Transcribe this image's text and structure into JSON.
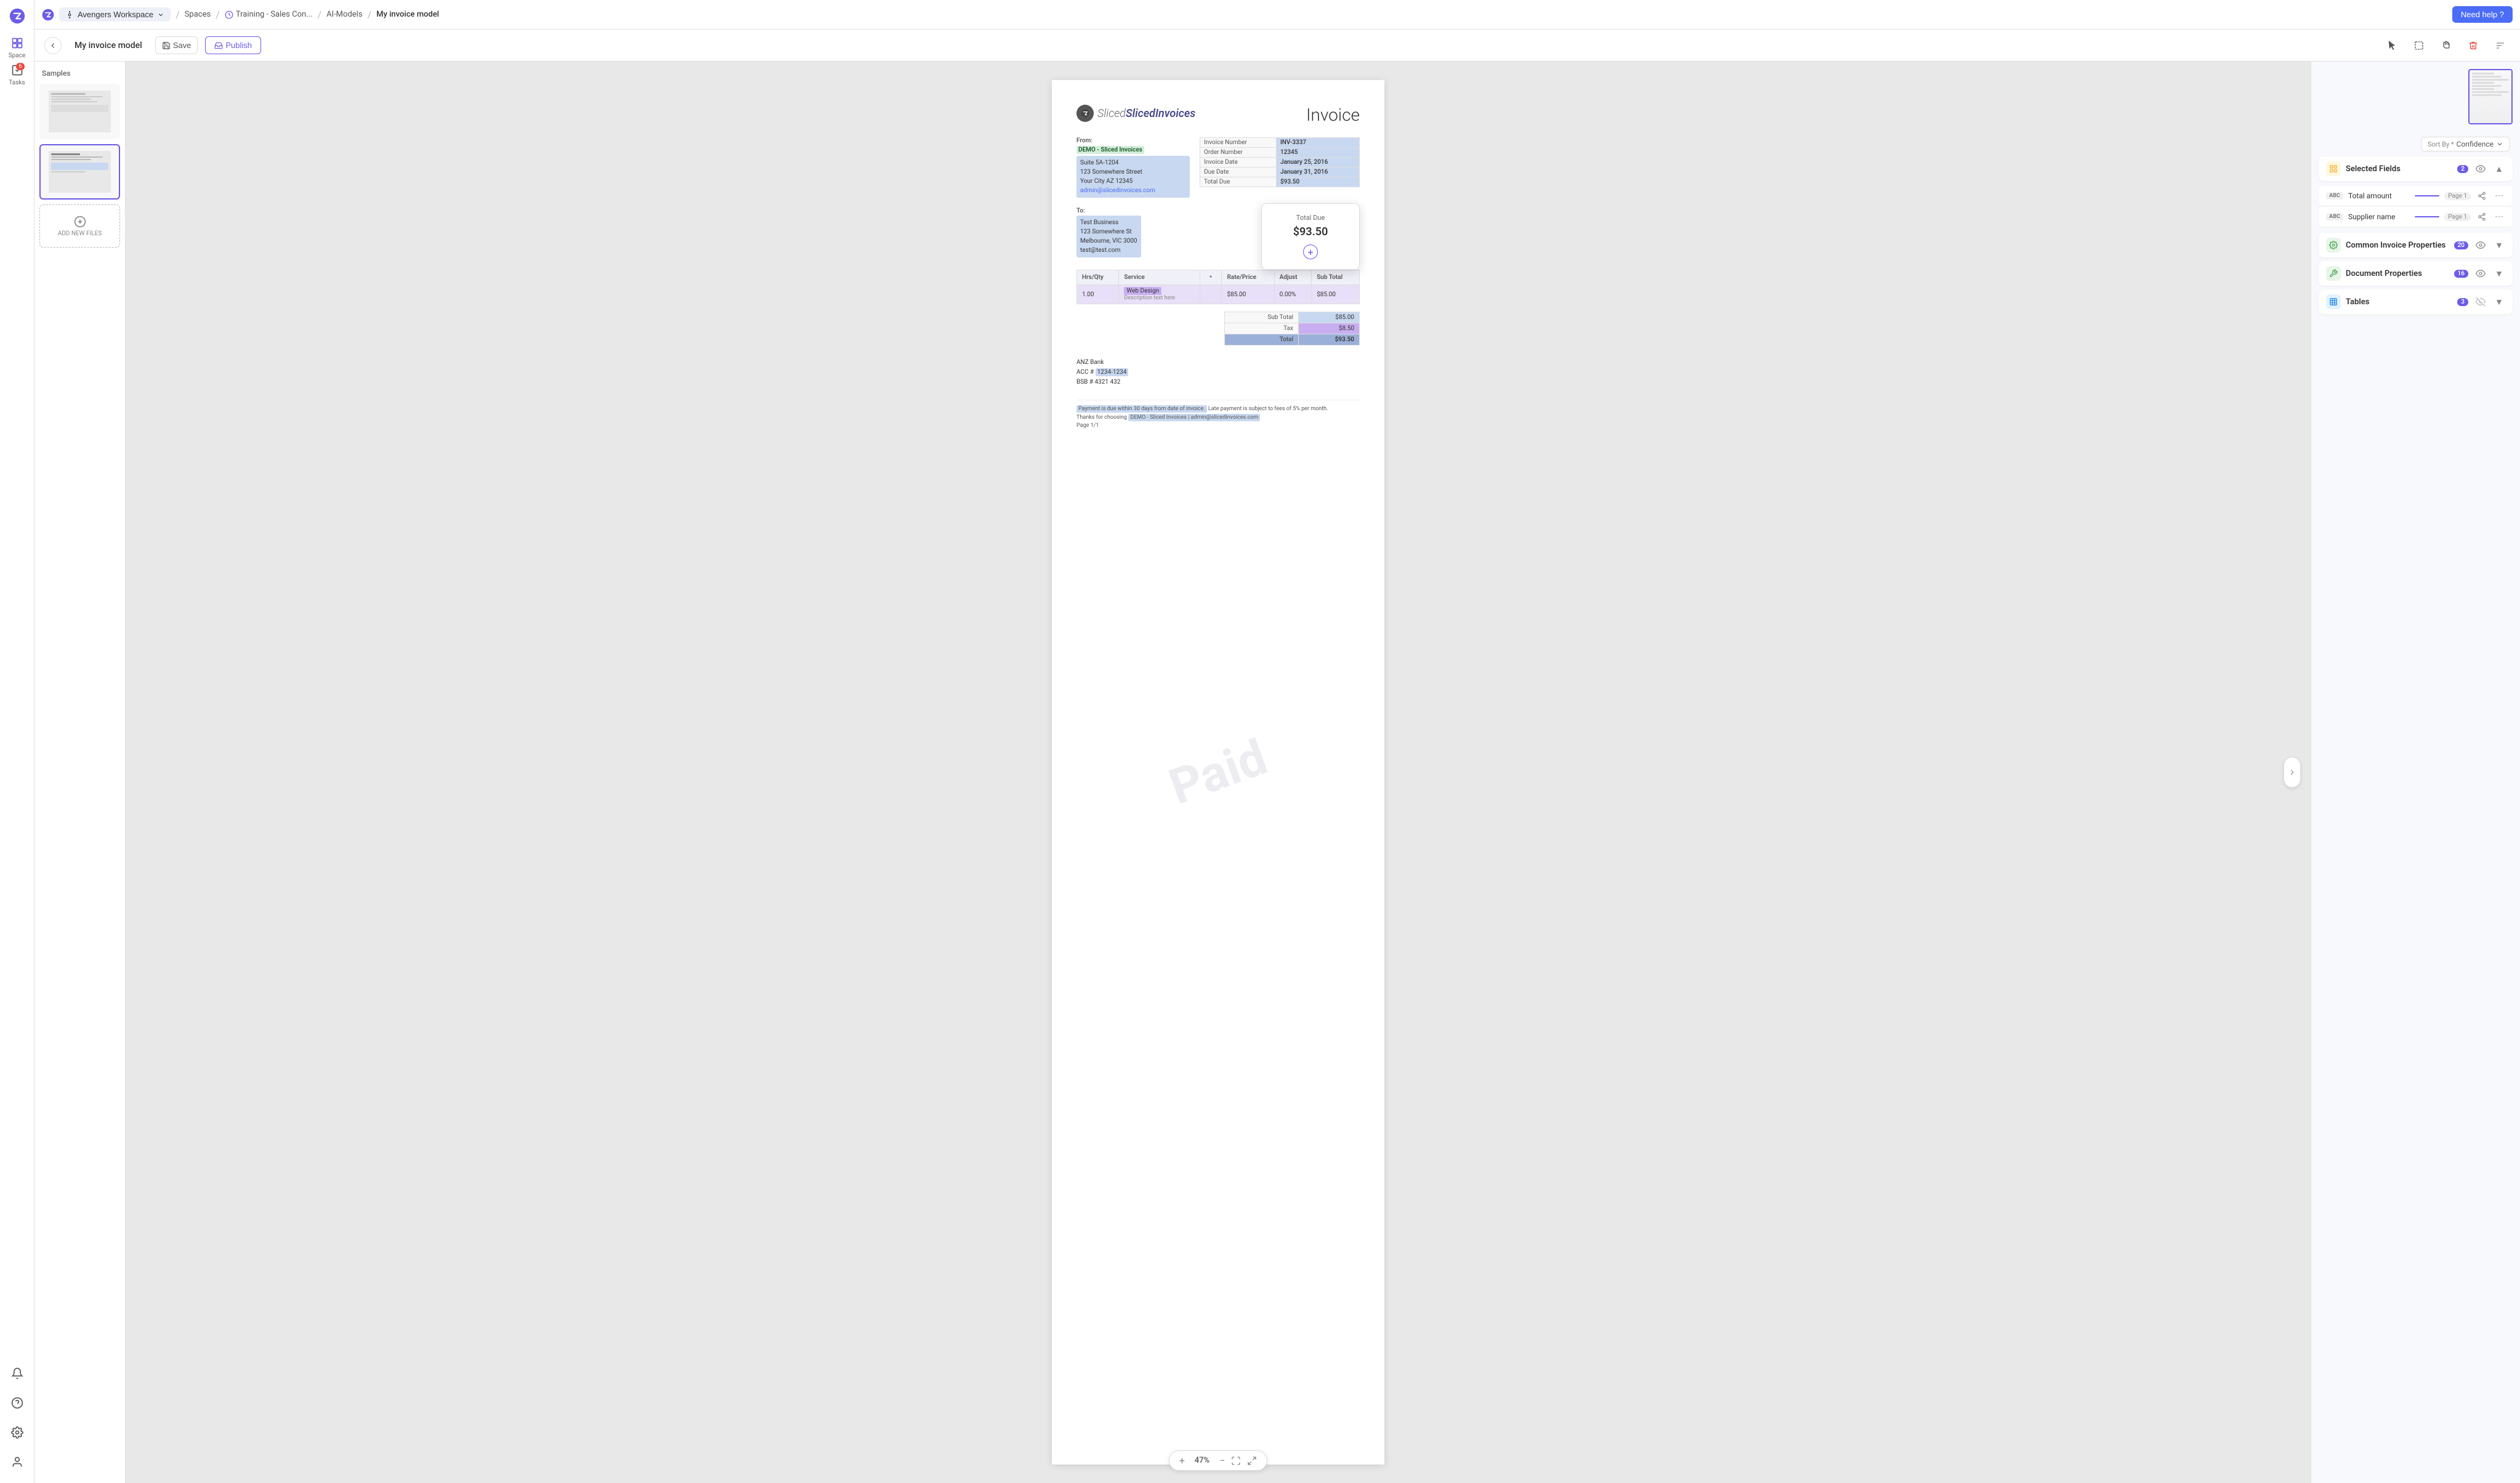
{
  "app": {
    "logo": "zenphi",
    "logo_color": "#6c5ce7"
  },
  "topbar": {
    "workspace": "Avengers Workspace",
    "spaces": "Spaces",
    "training": "Training - Sales Con...",
    "ai_models": "AI-Models",
    "current_page": "My invoice model",
    "help_button": "Need help ?"
  },
  "toolbar": {
    "back_label": "←",
    "model_name": "My invoice model",
    "save_label": "Save",
    "publish_label": "Publish"
  },
  "samples_panel": {
    "title": "Samples",
    "add_files_label": "ADD NEW FILES"
  },
  "invoice": {
    "logo_text": "SlicedInvoices",
    "title": "Invoice",
    "from_label": "From:",
    "from_name": "DEMO - Sliced Invoices",
    "from_address": "Suite 5A-1204\n123 Somewhere Street\nYour City AZ 12345\nadmin@slicedinvoices.com",
    "details": [
      {
        "label": "Invoice Number",
        "value": "INV-3337"
      },
      {
        "label": "Order Number",
        "value": "12345"
      },
      {
        "label": "Invoice Date",
        "value": "January 25, 2016"
      },
      {
        "label": "Due Date",
        "value": "January 31, 2016"
      },
      {
        "label": "Total Due",
        "value": "$93.50"
      }
    ],
    "to_label": "To:",
    "to_name": "Test Business",
    "to_address": "123 Somewhere St\nMelbourne, VIC 3000\ntest@test.com",
    "total_due_popup": {
      "title": "Total Due",
      "amount": "$93.50",
      "add_icon": "+"
    },
    "items_headers": [
      "Hrs/Qty",
      "Service",
      "Rate/Price",
      "Adjust",
      "Sub Total"
    ],
    "items_rows": [
      {
        "qty": "1.00",
        "service": "Web Design",
        "rate": "$85.00",
        "adjust": "0.00%",
        "subtotal": "$85.00"
      }
    ],
    "subtotal_label": "Sub Total",
    "subtotal_value": "$85.00",
    "tax_label": "Tax",
    "tax_value": "$8.50",
    "total_label": "Total",
    "total_value": "$93.50",
    "watermark": "Paid",
    "bank_name": "ANZ Bank",
    "bank_acc": "ACC # 1234-1234",
    "bank_bsb": "BSB # 4321 432",
    "footer_text": "Payment is due within 30 days from date of invoice. Late payment is subject to fees of 5% per month.",
    "footer_thanks": "Thanks for choosing",
    "footer_link": "DEMO - Sliced Invoices | admin@slicedinvoices.com",
    "footer_page": "Page 1/1"
  },
  "zoom": {
    "percent": "47%"
  },
  "right_panel": {
    "sort_label": "Sort By * Confidence",
    "sort_placeholder": "Confidence",
    "selected_fields_label": "Selected Fields",
    "selected_fields_count": "2",
    "fields": [
      {
        "type": "ABC",
        "name": "Total amount",
        "page": "Page 1"
      },
      {
        "type": "ABC",
        "name": "Supplier name",
        "page": "Page 1"
      }
    ],
    "common_invoice_label": "Common Invoice Properties",
    "common_invoice_count": "20",
    "document_props_label": "Document Properties",
    "document_props_count": "16",
    "tables_label": "Tables",
    "tables_count": "3"
  },
  "nav": {
    "space_label": "Space",
    "tasks_label": "Tasks",
    "tasks_badge": "6"
  }
}
